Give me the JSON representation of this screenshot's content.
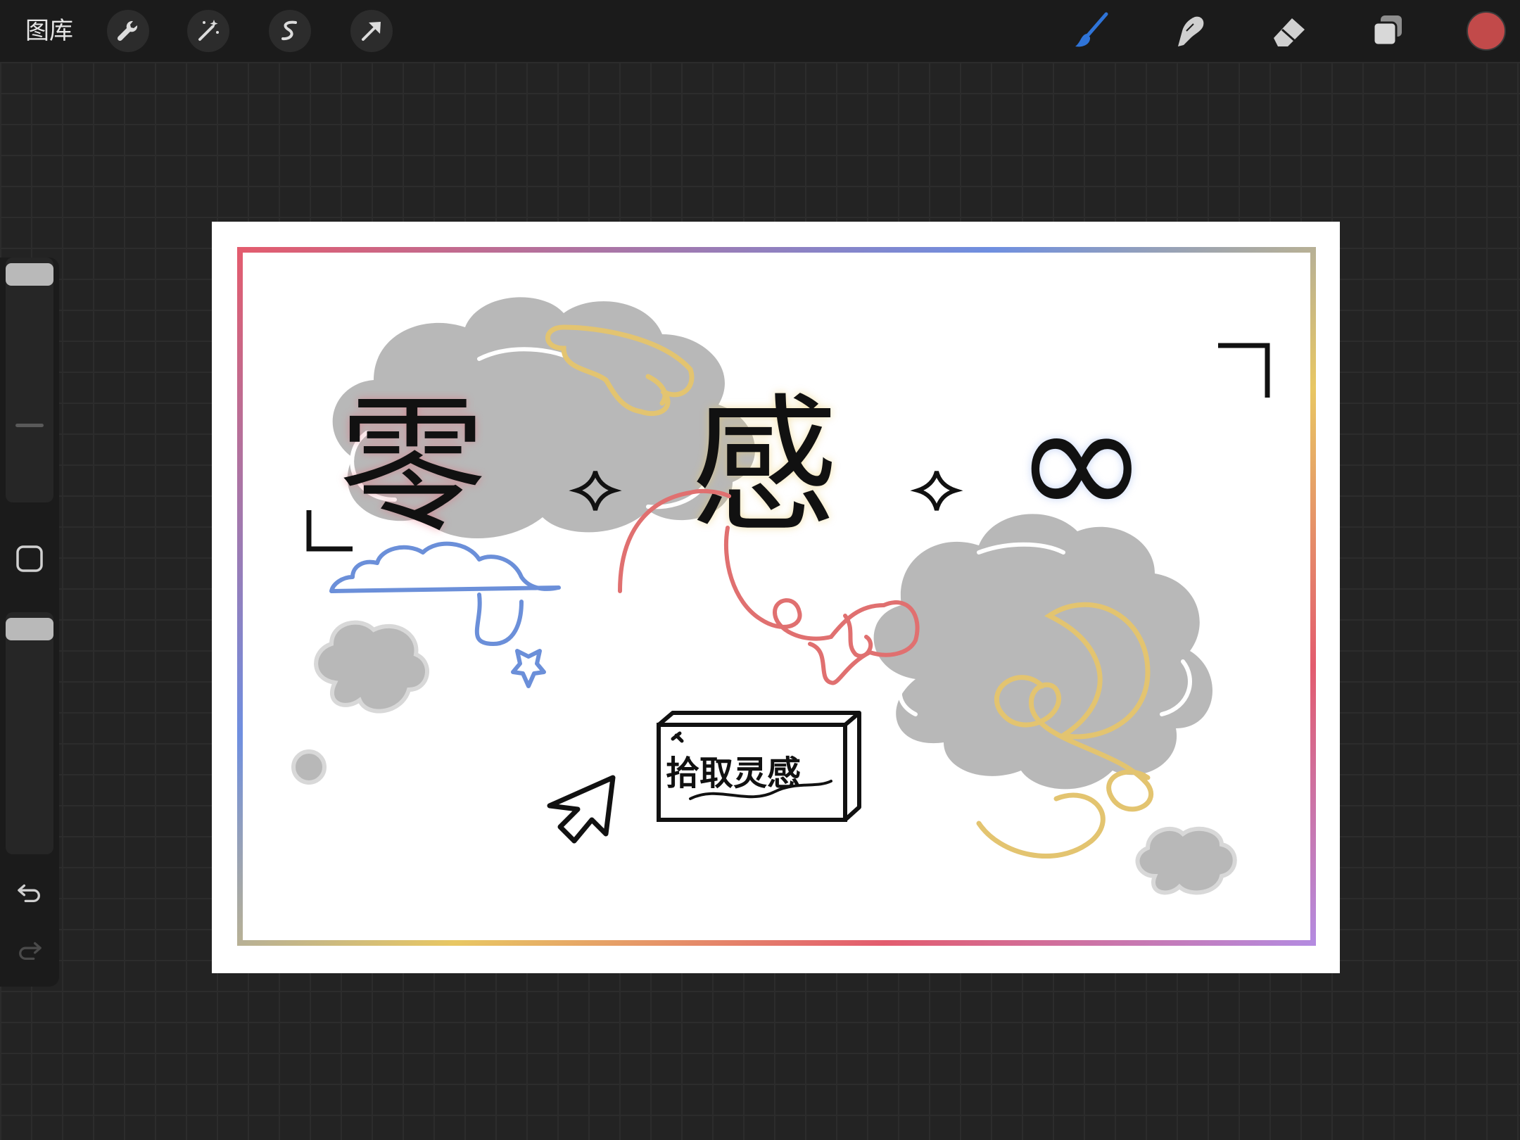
{
  "toolbar": {
    "gallery_label": "图库",
    "left_tools": [
      "wrench-icon",
      "magic-wand-icon",
      "selection-icon",
      "transform-arrow-icon"
    ],
    "right_tools": [
      "brush-icon",
      "smudge-icon",
      "eraser-icon",
      "layers-icon"
    ],
    "active_tool": "brush-icon",
    "active_tool_color": "#2f74d8",
    "current_color": "#c24a4a"
  },
  "sidebar": {
    "size_slider_icon": "size-slider",
    "modify_button_icon": "square-modify-icon",
    "opacity_slider_icon": "opacity-slider",
    "undo_icon": "undo-arrow-icon",
    "redo_icon": "redo-arrow-icon"
  },
  "canvas": {
    "big_char_1": "零",
    "big_char_2": "感",
    "infinity_symbol": "∞",
    "box_text": "拾取灵感",
    "frame_colors": [
      "#e35c6e",
      "#6f8fe0",
      "#e8c763",
      "#b48be0"
    ],
    "cloud_color": "#b8b8b8",
    "accent_blue": "#6b8fd9",
    "accent_red": "#e07070",
    "accent_yellow": "#e3c470"
  }
}
